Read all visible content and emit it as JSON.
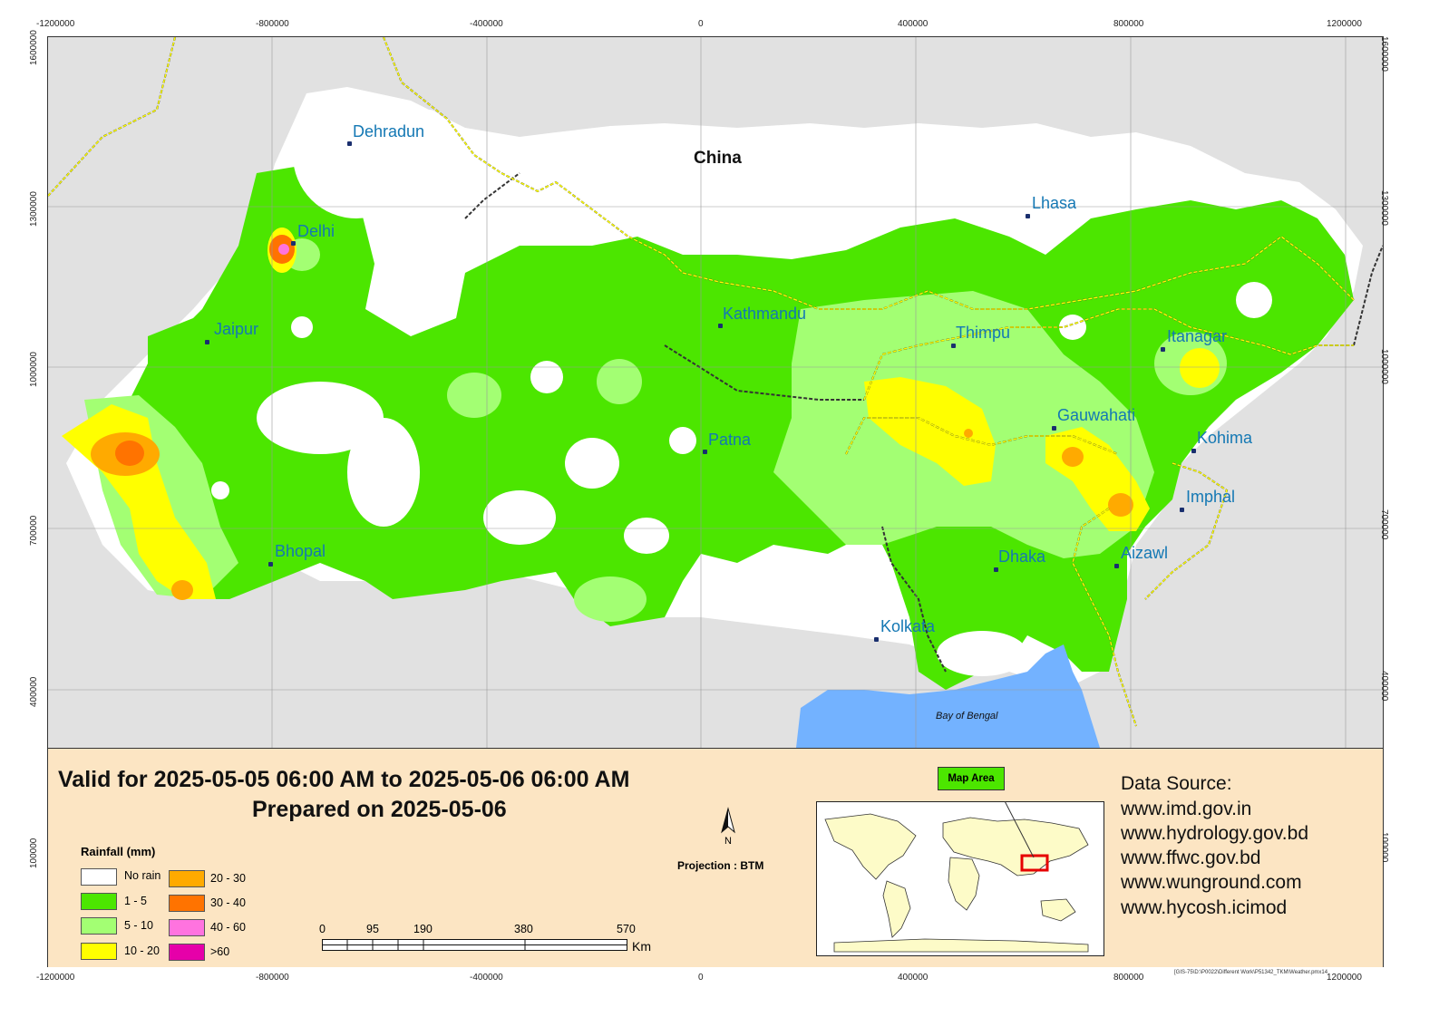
{
  "axis": {
    "x_ticks": [
      "-1200000",
      "-800000",
      "-400000",
      "0",
      "400000",
      "800000",
      "1200000"
    ],
    "y_ticks": [
      "1600000",
      "1300000",
      "1000000",
      "700000",
      "400000",
      "100000"
    ]
  },
  "places": {
    "country": "China",
    "sea": "Bay of Bengal",
    "cities": [
      "Dehradun",
      "Delhi",
      "Jaipur",
      "Bhopal",
      "Kathmandu",
      "Patna",
      "Kolkata",
      "Thimpu",
      "Lhasa",
      "Itanagar",
      "Gauwahati",
      "Kohima",
      "Imphal",
      "Dhaka",
      "Aizawl"
    ]
  },
  "panel": {
    "valid_line": "Valid for 2025-05-05 06:00 AM  to 2025-05-06 06:00 AM",
    "prepared_line": "Prepared on 2025-05-06",
    "legend_title": "Rainfall (mm)",
    "legend": [
      {
        "label": "No rain",
        "color": "#ffffff"
      },
      {
        "label": "1 - 5",
        "color": "#4ce600"
      },
      {
        "label": "5 - 10",
        "color": "#a3ff73"
      },
      {
        "label": "10 - 20",
        "color": "#ffff00"
      },
      {
        "label": "20 - 30",
        "color": "#ffaa00"
      },
      {
        "label": "30 - 40",
        "color": "#ff7300"
      },
      {
        "label": "40 - 60",
        "color": "#ff73df"
      },
      {
        "label": ">60",
        "color": "#e600a9"
      }
    ],
    "north": "N",
    "projection": "Projection : BTM",
    "scale_ticks": [
      "0",
      "95",
      "190",
      "380",
      "570"
    ],
    "scale_unit": "Km",
    "map_area_label": "Map Area",
    "data_source_title": "Data Source:",
    "data_sources": [
      "www.imd.gov.in",
      "www.hydrology.gov.bd",
      "www.ffwc.gov.bd",
      "www.wunground.com",
      "www.hycosh.icimod"
    ],
    "footer_path": "[GIS-75\\D:\\P0022\\Different Work\\P51342_TKM\\Weather.pmx14"
  },
  "colors": {
    "outside": "#e1e1e1",
    "sea": "#73b2ff",
    "border": "#ffff00",
    "panel": "#fce5c3"
  }
}
